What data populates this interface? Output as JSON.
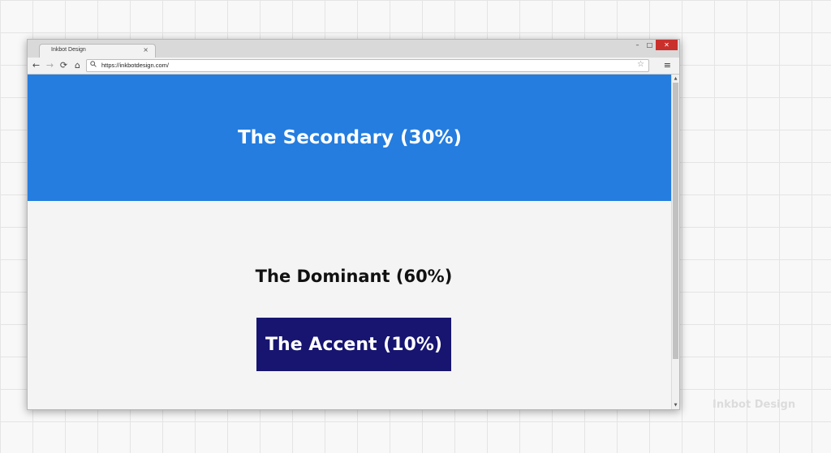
{
  "browser": {
    "tab_title": "Inkbot Design",
    "tab_close": "×",
    "url": "https://inkbotdesign.com/",
    "icons": {
      "back": "←",
      "forward": "→",
      "reload": "⟳",
      "home": "⌂",
      "search": "🔍",
      "star": "☆",
      "menu": "≡",
      "minimize": "–",
      "maximize": "□",
      "close": "✕"
    }
  },
  "content": {
    "secondary_label": "The Secondary (30%)",
    "dominant_label": "The Dominant (60%)",
    "accent_label": "The Accent (10%)"
  },
  "colors": {
    "secondary": "#247ddf",
    "dominant": "#f4f4f5",
    "accent": "#171570"
  },
  "watermark": "Inkbot Design"
}
